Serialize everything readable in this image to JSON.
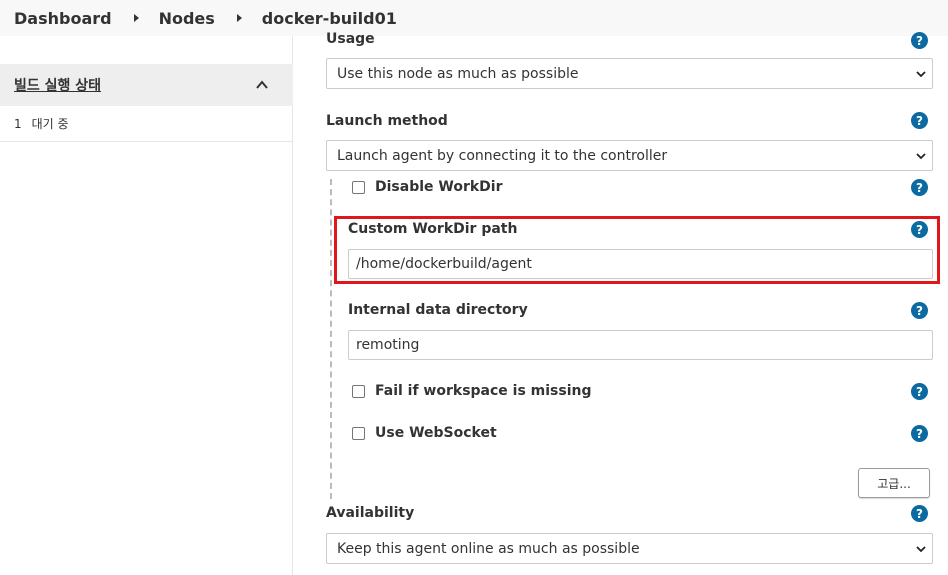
{
  "breadcrumb": {
    "items": [
      "Dashboard",
      "Nodes",
      "docker-build01"
    ]
  },
  "sidebar": {
    "executor_status_title": "빌드 실행 상태",
    "executors": [
      {
        "num": "1",
        "status": "대기 중"
      }
    ]
  },
  "form": {
    "usage": {
      "label": "Usage",
      "value": "Use this node as much as possible"
    },
    "launch_method": {
      "label": "Launch method",
      "value": "Launch agent by connecting it to the controller"
    },
    "disable_workdir": {
      "label": "Disable WorkDir",
      "checked": false
    },
    "custom_workdir": {
      "label": "Custom WorkDir path",
      "value": "/home/dockerbuild/agent"
    },
    "internal_data_dir": {
      "label": "Internal data directory",
      "value": "remoting"
    },
    "fail_if_missing": {
      "label": "Fail if workspace is missing",
      "checked": false
    },
    "use_websocket": {
      "label": "Use WebSocket",
      "checked": false
    },
    "advanced_button": "고급...",
    "availability": {
      "label": "Availability",
      "value": "Keep this agent online as much as possible"
    },
    "help_glyph": "?"
  },
  "colors": {
    "help": "#0b6aa2",
    "highlight": "#e0161d"
  }
}
